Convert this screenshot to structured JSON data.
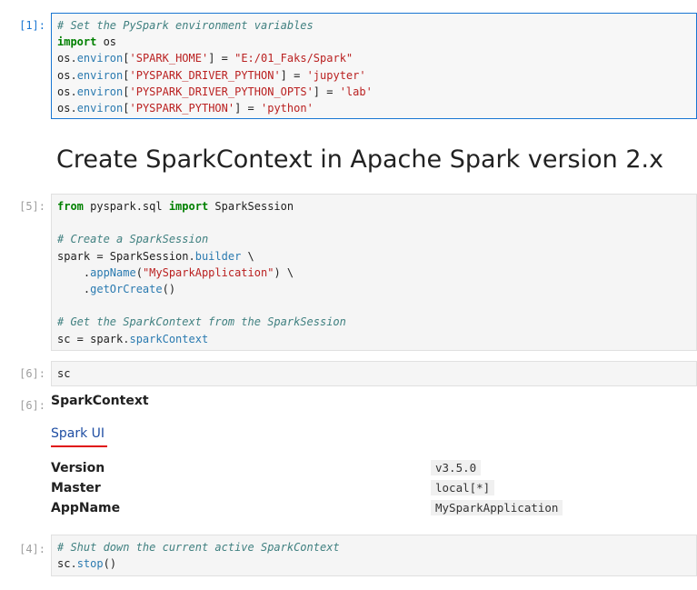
{
  "cells": [
    {
      "prompt": "[1]:",
      "lines": [
        [
          {
            "t": "# Set the PySpark environment variables",
            "c": "cm"
          }
        ],
        [
          {
            "t": "import",
            "c": "kw"
          },
          {
            "t": " os",
            "c": ""
          }
        ],
        [
          {
            "t": "os",
            "c": ""
          },
          {
            "t": ".",
            "c": "op"
          },
          {
            "t": "environ",
            "c": "attr"
          },
          {
            "t": "[",
            "c": ""
          },
          {
            "t": "'SPARK_HOME'",
            "c": "str"
          },
          {
            "t": "] = ",
            "c": ""
          },
          {
            "t": "\"E:/01_Faks/Spark\"",
            "c": "str"
          }
        ],
        [
          {
            "t": "os",
            "c": ""
          },
          {
            "t": ".",
            "c": "op"
          },
          {
            "t": "environ",
            "c": "attr"
          },
          {
            "t": "[",
            "c": ""
          },
          {
            "t": "'PYSPARK_DRIVER_PYTHON'",
            "c": "str"
          },
          {
            "t": "] = ",
            "c": ""
          },
          {
            "t": "'jupyter'",
            "c": "str"
          }
        ],
        [
          {
            "t": "os",
            "c": ""
          },
          {
            "t": ".",
            "c": "op"
          },
          {
            "t": "environ",
            "c": "attr"
          },
          {
            "t": "[",
            "c": ""
          },
          {
            "t": "'PYSPARK_DRIVER_PYTHON_OPTS'",
            "c": "str"
          },
          {
            "t": "] = ",
            "c": ""
          },
          {
            "t": "'lab'",
            "c": "str"
          }
        ],
        [
          {
            "t": "os",
            "c": ""
          },
          {
            "t": ".",
            "c": "op"
          },
          {
            "t": "environ",
            "c": "attr"
          },
          {
            "t": "[",
            "c": ""
          },
          {
            "t": "'PYSPARK_PYTHON'",
            "c": "str"
          },
          {
            "t": "] = ",
            "c": ""
          },
          {
            "t": "'python'",
            "c": "str"
          }
        ]
      ]
    },
    {
      "prompt": "[5]:",
      "lines": [
        [
          {
            "t": "from",
            "c": "kw"
          },
          {
            "t": " pyspark.sql ",
            "c": ""
          },
          {
            "t": "import",
            "c": "kw"
          },
          {
            "t": " SparkSession",
            "c": ""
          }
        ],
        [],
        [
          {
            "t": "# Create a SparkSession",
            "c": "cm"
          }
        ],
        [
          {
            "t": "spark = SparkSession",
            "c": ""
          },
          {
            "t": ".",
            "c": "op"
          },
          {
            "t": "builder",
            "c": "attr"
          },
          {
            "t": " \\",
            "c": ""
          }
        ],
        [
          {
            "t": "    .",
            "c": ""
          },
          {
            "t": "appName",
            "c": "attr"
          },
          {
            "t": "(",
            "c": ""
          },
          {
            "t": "\"MySparkApplication\"",
            "c": "str"
          },
          {
            "t": ") \\",
            "c": ""
          }
        ],
        [
          {
            "t": "    .",
            "c": ""
          },
          {
            "t": "getOrCreate",
            "c": "attr"
          },
          {
            "t": "()",
            "c": ""
          }
        ],
        [],
        [
          {
            "t": "# Get the SparkContext from the SparkSession",
            "c": "cm"
          }
        ],
        [
          {
            "t": "sc = spark",
            "c": ""
          },
          {
            "t": ".",
            "c": "op"
          },
          {
            "t": "sparkContext",
            "c": "attr"
          }
        ]
      ]
    },
    {
      "prompt": "[6]:",
      "lines": [
        [
          {
            "t": "sc",
            "c": ""
          }
        ]
      ]
    },
    {
      "prompt": "[4]:",
      "lines": [
        [
          {
            "t": "# Shut down the current active SparkContext",
            "c": "cm"
          }
        ],
        [
          {
            "t": "sc",
            "c": ""
          },
          {
            "t": ".",
            "c": "op"
          },
          {
            "t": "stop",
            "c": "attr"
          },
          {
            "t": "()",
            "c": ""
          }
        ]
      ]
    }
  ],
  "heading": "Create SparkContext in Apache Spark version 2.x",
  "output": {
    "prompt": "[6]:",
    "title": "SparkContext",
    "link": "Spark UI",
    "rows": [
      {
        "key": "Version",
        "value": "v3.5.0"
      },
      {
        "key": "Master",
        "value": "local[*]"
      },
      {
        "key": "AppName",
        "value": "MySparkApplication"
      }
    ]
  },
  "colors": {
    "active_border": "#1976d2",
    "comment": "#408080",
    "keyword": "#008000",
    "string": "#ba2121",
    "attribute": "#2a7ab0",
    "underline": "#e01010"
  }
}
